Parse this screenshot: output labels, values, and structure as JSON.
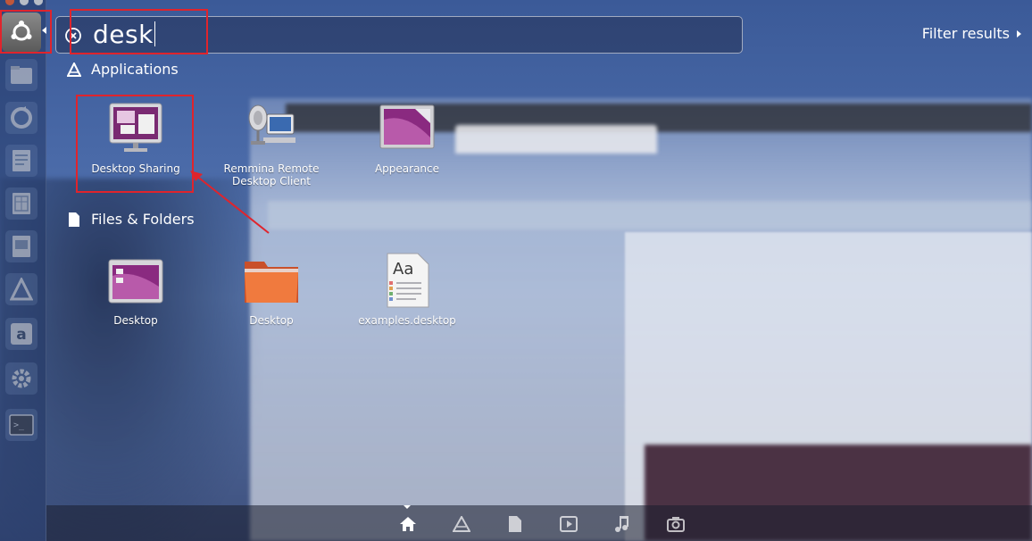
{
  "search": {
    "query": "desk",
    "filter_label": "Filter results"
  },
  "categories": {
    "applications": {
      "title": "Applications",
      "items": [
        {
          "label": "Desktop Sharing",
          "icon": "desktop-sharing-icon"
        },
        {
          "label": "Remmina Remote Desktop Client",
          "icon": "remmina-icon"
        },
        {
          "label": "Appearance",
          "icon": "appearance-icon"
        }
      ]
    },
    "files": {
      "title": "Files & Folders",
      "items": [
        {
          "label": "Desktop",
          "icon": "desktop-folder-purple-icon"
        },
        {
          "label": "Desktop",
          "icon": "desktop-folder-orange-icon"
        },
        {
          "label": "examples.desktop",
          "icon": "text-file-icon"
        }
      ]
    }
  },
  "lenses": [
    "home-lens-icon",
    "applications-lens-icon",
    "files-lens-icon",
    "video-lens-icon",
    "music-lens-icon",
    "photo-lens-icon"
  ],
  "launcher": [
    "dash-home-icon",
    "files-app-icon",
    "backup-icon",
    "writer-icon",
    "calc-icon",
    "impress-icon",
    "software-center-icon",
    "amazon-icon",
    "settings-icon",
    "terminal-icon"
  ],
  "colors": {
    "highlight": "#e0242c",
    "ubuntu_purple": "#77216f",
    "folder_orange": "#e9673a"
  }
}
